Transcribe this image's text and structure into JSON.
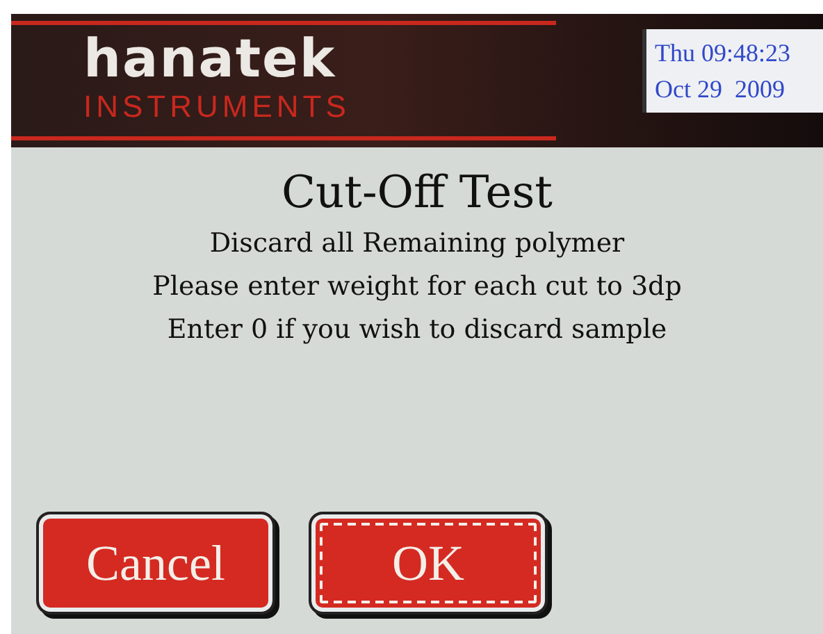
{
  "header": {
    "logo": "hanatek",
    "logo_subtitle": "INSTRUMENTS",
    "clock": {
      "time": "Thu 09:48:23",
      "date": "Oct 29  2009"
    }
  },
  "title": "Cut-Off Test",
  "instructions": [
    "Discard all Remaining polymer",
    "Please enter weight for each cut to 3dp",
    "Enter 0 if you wish to discard sample"
  ],
  "buttons": [
    {
      "label": "Cancel",
      "focused": false
    },
    {
      "label": "OK",
      "focused": true
    }
  ]
}
